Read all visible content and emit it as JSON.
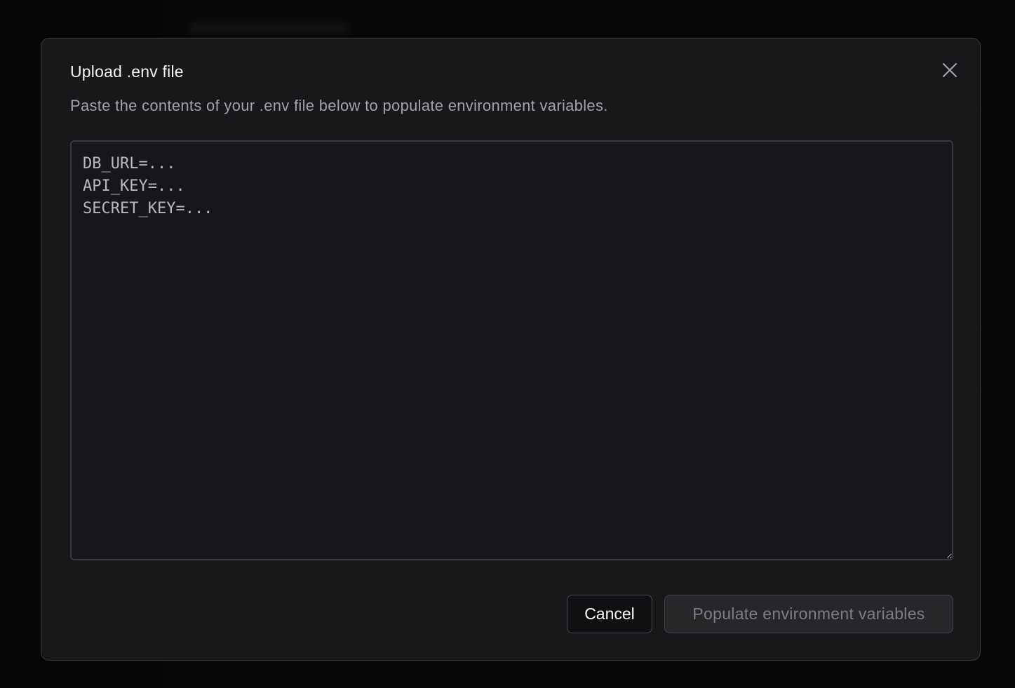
{
  "modal": {
    "title": "Upload .env file",
    "description": "Paste the contents of your .env file below to populate environment variables.",
    "close_icon": "close-icon",
    "textarea_placeholder": "DB_URL=...\nAPI_KEY=...\nSECRET_KEY=...",
    "textarea_value": "",
    "cancel_label": "Cancel",
    "submit_label": "Populate environment variables",
    "submit_disabled": true
  },
  "colors": {
    "modal_bg": "#18181b",
    "border": "#3a3a3f",
    "title": "#f4f4f5",
    "muted": "#a1a1aa"
  }
}
